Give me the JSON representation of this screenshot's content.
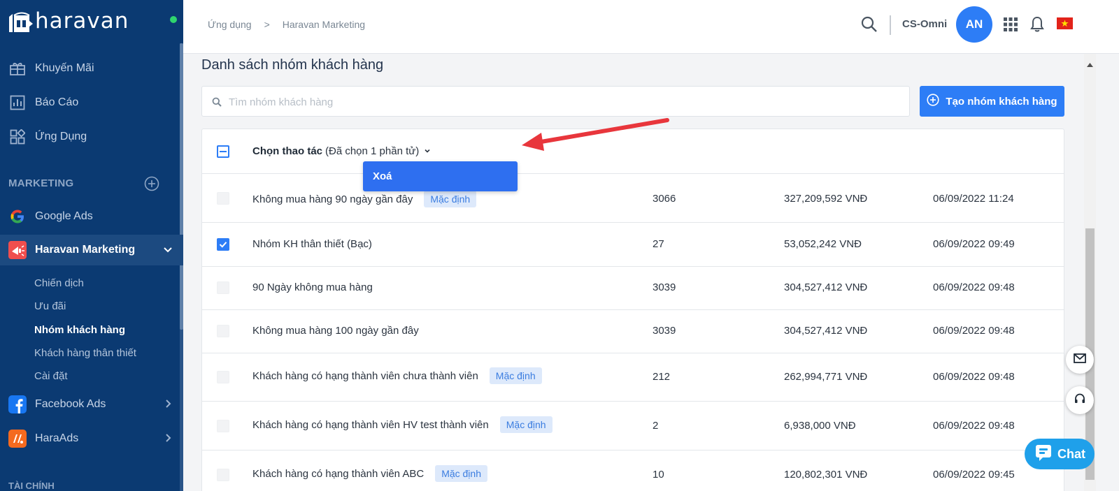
{
  "sidebar": {
    "brand": "haravan",
    "nav": [
      {
        "label": "Khuyến Mãi",
        "icon": "gift-icon"
      },
      {
        "label": "Báo Cáo",
        "icon": "report-icon"
      },
      {
        "label": "Ứng Dụng",
        "icon": "apps-icon"
      }
    ],
    "section_label": "MARKETING",
    "marketing_items": [
      {
        "label": "Google Ads",
        "icon": "google-icon"
      },
      {
        "label": "Haravan Marketing",
        "icon": "haravan-marketing-icon"
      },
      {
        "label": "Facebook Ads",
        "icon": "facebook-icon"
      },
      {
        "label": "HaraAds",
        "icon": "haraads-icon"
      }
    ],
    "sub_items": [
      {
        "label": "Chiến dịch"
      },
      {
        "label": "Ưu đãi"
      },
      {
        "label": "Nhóm khách hàng"
      },
      {
        "label": "Khách hàng thân thiết"
      },
      {
        "label": "Cài đặt"
      }
    ],
    "bottom_section_partial": "TÀI CHÍNH"
  },
  "header": {
    "breadcrumb": [
      "Ứng dụng",
      "Haravan Marketing"
    ],
    "breadcrumb_sep": ">",
    "store_name": "CS-Omni",
    "avatar_initials": "AN"
  },
  "main": {
    "page_title": "Danh sách nhóm khách hàng",
    "search_placeholder": "Tìm nhóm khách hàng",
    "search_value": "",
    "create_button": "Tạo nhóm khách hàng",
    "bulk_action_label": "Chọn thao tác",
    "bulk_selected_text": "(Đã chọn 1 phần tử)",
    "dropdown_option": "Xoá",
    "badge_default": "Mặc định",
    "rows": [
      {
        "name": "Không mua hàng 90 ngày gần đây",
        "badge": "Mặc định",
        "count": "3066",
        "revenue": "327,209,592 VNĐ",
        "date": "06/09/2022 11:24",
        "checked": false
      },
      {
        "name": "Nhóm KH thân thiết (Bạc)",
        "badge": "",
        "count": "27",
        "revenue": "53,052,242 VNĐ",
        "date": "06/09/2022 09:49",
        "checked": true
      },
      {
        "name": "90 Ngày không mua hàng",
        "badge": "",
        "count": "3039",
        "revenue": "304,527,412 VNĐ",
        "date": "06/09/2022 09:48",
        "checked": false
      },
      {
        "name": "Không mua hàng 100 ngày gần đây",
        "badge": "",
        "count": "3039",
        "revenue": "304,527,412 VNĐ",
        "date": "06/09/2022 09:48",
        "checked": false
      },
      {
        "name": "Khách hàng có hạng thành viên chưa thành viên",
        "badge": "Mặc định",
        "count": "212",
        "revenue": "262,994,771 VNĐ",
        "date": "06/09/2022 09:48",
        "checked": false
      },
      {
        "name": "Khách hàng có hạng thành viên HV test thành viên",
        "badge": "Mặc định",
        "count": "2",
        "revenue": "6,938,000 VNĐ",
        "date": "06/09/2022 09:48",
        "checked": false
      },
      {
        "name": "Khách hàng có hạng thành viên ABC",
        "badge": "Mặc định",
        "count": "10",
        "revenue": "120,802,301 VNĐ",
        "date": "06/09/2022 09:45",
        "checked": false
      }
    ]
  },
  "widgets": {
    "chat_label": "Chat"
  },
  "colors": {
    "sidebar_bg": "#0b3a72",
    "primary": "#2d7df6",
    "badge_bg": "#dde9fb",
    "annotation_arrow": "#e8363c"
  }
}
